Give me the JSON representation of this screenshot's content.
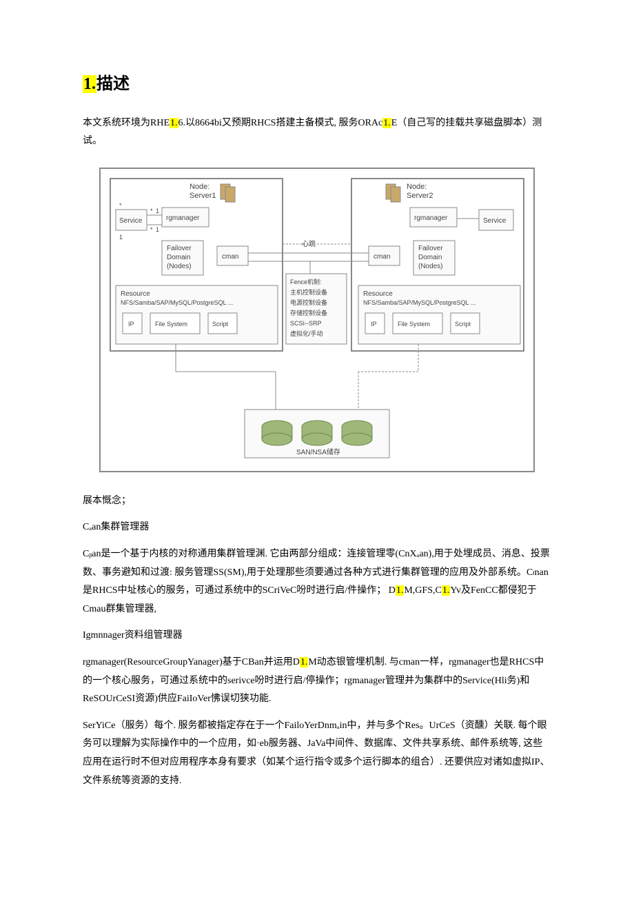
{
  "heading": {
    "num": "1.",
    "title": "描述"
  },
  "p1_a": "本文系统环境为RHE",
  "p1_hl1": "1.",
  "p1_b": "6.以8664bi又预期RHCS搭建主备模式, 服务ORAc",
  "p1_hl2": "1.",
  "p1_c": "E（自己写的挂载共享磁盘脚本）测试。",
  "diagram": {
    "node1": "Node:",
    "server1": "Server1",
    "node2": "Node:",
    "server2": "Server2",
    "service": "Service",
    "rgmanager": "rgmanager",
    "failover": "Failover",
    "domain": "Domain",
    "nodes": "(Nodes)",
    "cman": "cman",
    "heartbeat": "心跳",
    "resource": "Resource",
    "nfs": "NFS/Samba/SAP/MySQL/PostgreSQL ...",
    "ip": "IP",
    "fs": "File System",
    "script": "Script",
    "fence1": "Fence机制:",
    "fence2": "主机控制设备",
    "fence3": "电源控制设备",
    "fence4": "存储控制设备",
    "fence5": "SCSI--SRP",
    "fence6": "虚拟化/手动",
    "san": "SAN/NSA储存",
    "one": "1",
    "star": "*"
  },
  "p2": "展本慨念；",
  "p3": "Cₐan集群管理器",
  "p4_a": "Cᵦan是一个基于内核的对称通用集群管理渊. 它由两部分组成：连接管理零(CnXₐan),用于处埋成员、消息、投票数、事务避知和过渡: 服务管理SS(SM),用于处理那些须要通过各种方式进行集群管理的应用及外部系统。Cₗnan是RHCS中址核心的服务，可通过系统中的SCriVeC吩时进行启/件操作； D",
  "p4_hl1": "1.",
  "p4_b": "M,GFS,C",
  "p4_hl2": "1.",
  "p4_c": "Yv及FenCC都侵犯于Cmau群集管理器,",
  "p5": "Igmnnager资料组管理器",
  "p6_a": "rgmanager(ResourceGroupYanager)基于CBan并运用D",
  "p6_hl1": "1.",
  "p6_b": "M动态银管埋机制. 与cman一样，rgmanager也是RHCS中的一个核心服务，可通过系统中的serivce吩时进行启/停操作；rgmanager管理并为集群中的Service(Hli务)和ReSOUrCeSI资源)供应FaiIoVer怫误切狭功能.",
  "p7": "SerYiCe（服务）每个. 服务都被指定存在于一个FailoYerDnmₐin中，并与多个Res。UrCeS（资醺）关联. 每个眼务可以理解为实际操作中的一个应用，如·eb服务器、JaVa中间件、数据库、文件共享系统、邮件系统等, 这些应用在运行时不但对应用程序本身有要求（如某个运行指令或多个运行脚本的组合）. 还要供应对诸如虚拟IP、文件系统等资源的支持."
}
